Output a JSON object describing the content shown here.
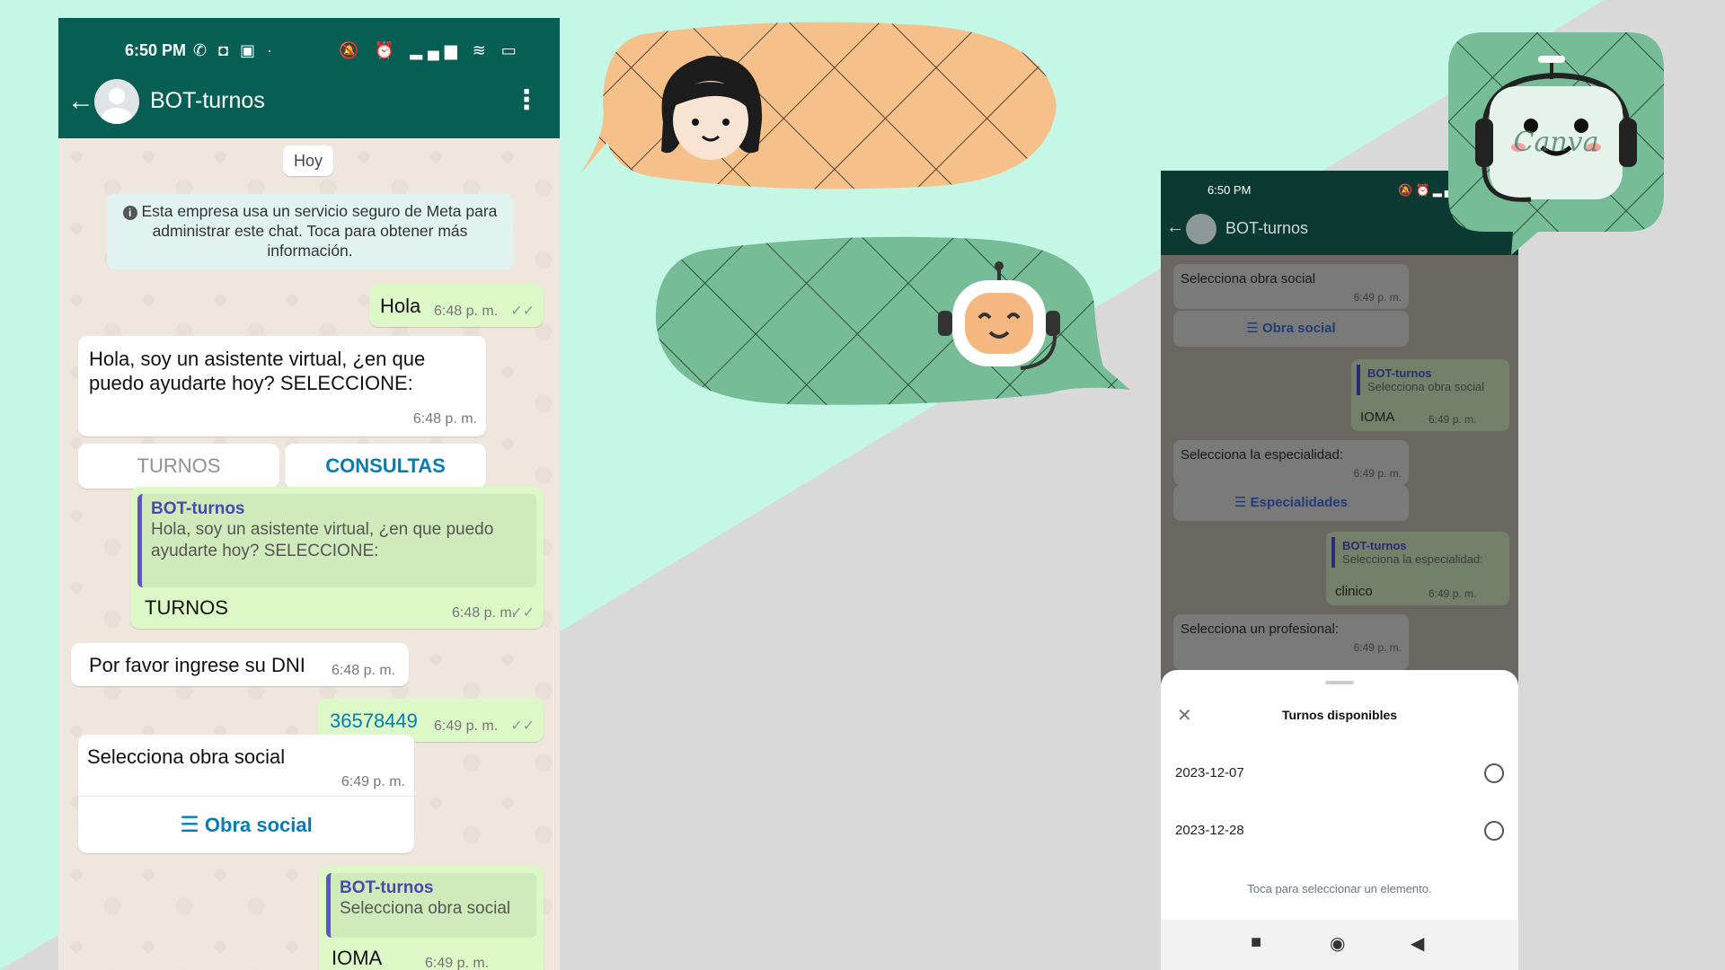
{
  "colors": {
    "mint": "#c4f7e6",
    "grey": "#d9d9d9",
    "whatsapp_green": "#075e54",
    "outgoing_bubble": "#dcf8c6",
    "speech_orange": "#f5c089",
    "speech_green": "#76bc97"
  },
  "left_phone": {
    "status_bar": {
      "time": "6:50 PM",
      "battery": "80"
    },
    "header": {
      "chat_name": "BOT-turnos"
    },
    "day_chip": "Hoy",
    "system_notice": "Esta empresa usa un servicio seguro de Meta para administrar este chat. Toca para obtener más información.",
    "messages": {
      "m1": {
        "text": "Hola",
        "time": "6:48 p. m."
      },
      "m2": {
        "text": "Hola, soy un asistente virtual, ¿en que puedo ayudarte hoy? SELECCIONE:",
        "time": "6:48 p. m."
      },
      "quick_replies": {
        "turnos": "TURNOS",
        "consultas": "CONSULTAS"
      },
      "m3": {
        "quote_name": "BOT-turnos",
        "quote_text": "Hola, soy un asistente virtual, ¿en que puedo ayudarte hoy? SELECCIONE:",
        "text": "TURNOS",
        "time": "6:48 p. m."
      },
      "m4": {
        "text": "Por favor ingrese su DNI",
        "time": "6:48 p. m."
      },
      "m5": {
        "text": "36578449",
        "time": "6:49 p. m."
      },
      "m6": {
        "text": "Selecciona obra social",
        "time": "6:49 p. m.",
        "button": "Obra social"
      },
      "m7": {
        "quote_name": "BOT-turnos",
        "quote_text": "Selecciona obra social",
        "text": "IOMA",
        "time": "6:49 p. m."
      }
    }
  },
  "right_phone": {
    "status_bar": {
      "time": "6:50 PM"
    },
    "header": {
      "chat_name": "BOT-turnos"
    },
    "messages": {
      "r1": {
        "text": "Selecciona obra social",
        "time": "6:49 p. m.",
        "button": "Obra social"
      },
      "r2": {
        "quote_name": "BOT-turnos",
        "quote_text": "Selecciona obra social",
        "text": "IOMA",
        "time": "6:49 p. m."
      },
      "r3": {
        "text": "Selecciona la especialidad:",
        "time": "6:49 p. m.",
        "button": "Especialidades"
      },
      "r4": {
        "quote_name": "BOT-turnos",
        "quote_text": "Selecciona la especialidad:",
        "text": "clinico",
        "time": "6:49 p. m."
      },
      "r5": {
        "text": "Selecciona un profesional:",
        "time": "6:49 p. m."
      }
    },
    "sheet": {
      "title": "Turnos disponibles",
      "options": [
        "2023-12-07",
        "2023-12-28"
      ],
      "hint": "Toca para seleccionar un elemento."
    }
  },
  "illustrations": {
    "logo_text": "Canva"
  }
}
